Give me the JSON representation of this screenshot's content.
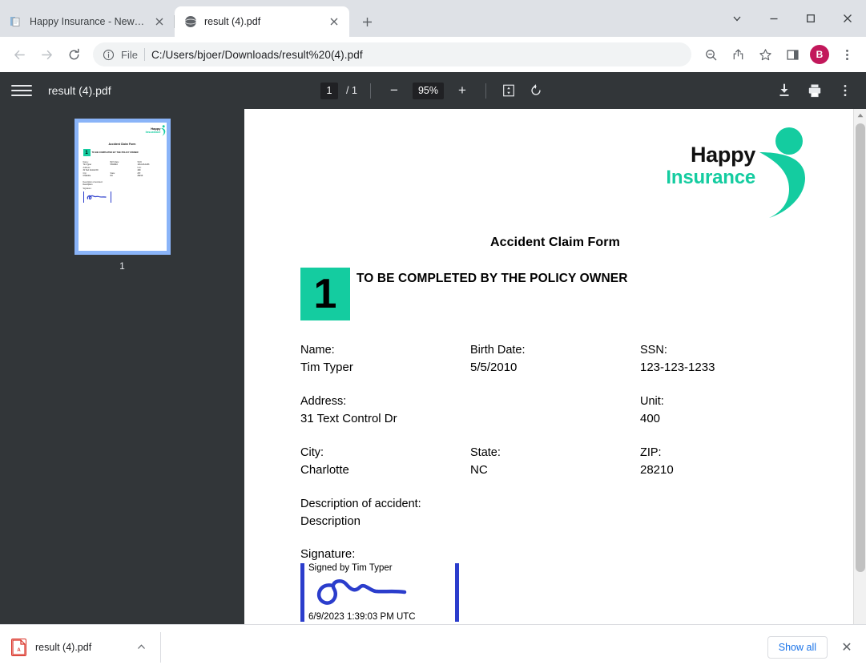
{
  "browser": {
    "tabs": [
      {
        "title": "Happy Insurance - New Claim",
        "favicon": "document-icon",
        "active": false
      },
      {
        "title": "result (4).pdf",
        "favicon": "globe-icon",
        "active": true
      }
    ],
    "newtab_label": "+",
    "window_controls": {
      "tab_search": "chevron-down-icon",
      "minimize": "minimize-icon",
      "maximize": "maximize-icon",
      "close": "close-icon"
    },
    "omnibox": {
      "back": "back-arrow-icon",
      "forward": "forward-arrow-icon",
      "reload": "reload-icon",
      "site_info": "info-icon",
      "scheme_label": "File",
      "url": "C:/Users/bjoer/Downloads/result%20(4).pdf",
      "zoom_icon": "zoom-out-icon",
      "share_icon": "share-icon",
      "bookmark_icon": "star-icon",
      "sidepanel_icon": "side-panel-icon",
      "profile_initial": "B",
      "menu_icon": "three-dot-menu-icon"
    }
  },
  "pdf_toolbar": {
    "menu_icon": "hamburger-menu-icon",
    "filename": "result (4).pdf",
    "page_current": "1",
    "page_separator": "/",
    "page_total": "1",
    "zoom_out": "−",
    "zoom_level": "95%",
    "zoom_in": "+",
    "fit_icon": "fit-to-page-icon",
    "rotate_icon": "rotate-icon",
    "download_icon": "download-icon",
    "print_icon": "print-icon",
    "more_icon": "more-options-icon"
  },
  "thumbnails": {
    "pages": [
      {
        "label": "1",
        "selected": true
      }
    ]
  },
  "document": {
    "logo": {
      "line1": "Happy",
      "line2": "Insurance",
      "accent_color": "#14cca0",
      "text_color": "#111111"
    },
    "title": "Accident Claim Form",
    "section": {
      "number": "1",
      "heading": "TO BE COMPLETED BY THE POLICY OWNER",
      "badge_color": "#14cca0"
    },
    "fields": [
      [
        {
          "label": "Name:",
          "value": "Tim Typer"
        },
        {
          "label": "Birth Date:",
          "value": "5/5/2010"
        },
        {
          "label": "SSN:",
          "value": "123-123-1233"
        }
      ],
      [
        {
          "label": "Address:",
          "value": "31 Text Control Dr"
        },
        {
          "label": "",
          "value": ""
        },
        {
          "label": "Unit:",
          "value": "400"
        }
      ],
      [
        {
          "label": "City:",
          "value": "Charlotte"
        },
        {
          "label": "State:",
          "value": "NC"
        },
        {
          "label": "ZIP:",
          "value": "28210"
        }
      ]
    ],
    "description": {
      "label": "Description of accident:",
      "value": "Description"
    },
    "signature": {
      "label": "Signature:",
      "signed_by": "Signed by Tim Typer",
      "date": "6/9/2023 1:39:03 PM UTC",
      "ink_color": "#2b3dcc"
    }
  },
  "download_shelf": {
    "file_icon": "pdf-file-icon",
    "filename": "result (4).pdf",
    "expand_icon": "chevron-up-icon",
    "show_all_label": "Show all",
    "close_label": "✕"
  }
}
